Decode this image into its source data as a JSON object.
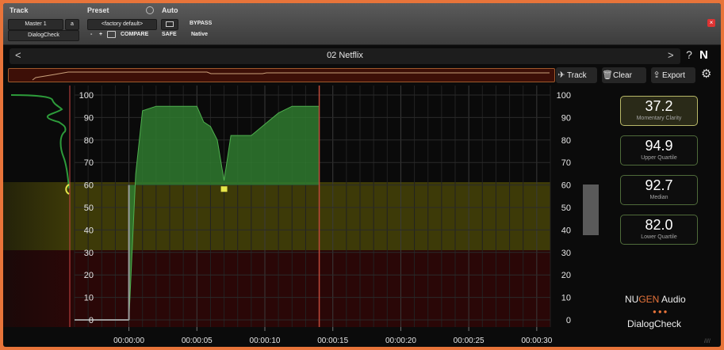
{
  "host": {
    "track_label": "Track",
    "preset_label": "Preset",
    "auto_label": "Auto",
    "track_name": "Master 1",
    "track_suffix": "a",
    "plugin_name": "DialogCheck",
    "preset_name": "<factory default>",
    "minus": "-",
    "plus": "+",
    "compare": "COMPARE",
    "safe": "SAFE",
    "bypass": "BYPASS",
    "native": "Native"
  },
  "titlebar": {
    "title": "02 Netflix",
    "prev": "<",
    "next": ">"
  },
  "toolbar": {
    "help": "?",
    "logo": "N",
    "track": "Track",
    "clear": "Clear",
    "export": "Export"
  },
  "graph": {
    "y_ticks": [
      "100",
      "90",
      "80",
      "70",
      "60",
      "50",
      "40",
      "30",
      "20",
      "10",
      "0"
    ],
    "x_ticks": [
      "00:00:00",
      "00:00:05",
      "00:00:10",
      "00:00:15",
      "00:00:20",
      "00:00:25",
      "00:00:30"
    ]
  },
  "stats": [
    {
      "value": "37.2",
      "label": "Momentary Clarity"
    },
    {
      "value": "94.9",
      "label": "Upper Quartile"
    },
    {
      "value": "92.7",
      "label": "Median"
    },
    {
      "value": "82.0",
      "label": "Lower Quartile"
    }
  ],
  "meter_value": 45,
  "branding": {
    "nu": "NU",
    "gen": "GEN",
    "audio": " Audio",
    "dots": "●●●",
    "product": "DialogCheck"
  },
  "colors": {
    "accent": "#e8743a",
    "good": "#2f7a2f",
    "warn": "#4a4a10",
    "bad": "#3a0a0a"
  },
  "chart_data": {
    "type": "area",
    "title": "02 Netflix",
    "xlabel": "",
    "ylabel": "",
    "ylim": [
      0,
      100
    ],
    "xlim_seconds": [
      -4,
      31
    ],
    "x_seconds": [
      -4,
      0,
      0.5,
      1,
      2,
      5,
      5.5,
      6,
      6.5,
      7,
      7.5,
      8,
      9,
      10,
      11,
      12,
      13,
      14
    ],
    "values": [
      0,
      0,
      65,
      93,
      95,
      95,
      88,
      86,
      80,
      62,
      82,
      82,
      82,
      87,
      92,
      95,
      95,
      95
    ],
    "bands": [
      {
        "name": "good",
        "from": 60,
        "to": 100
      },
      {
        "name": "caution",
        "from": 30,
        "to": 60
      },
      {
        "name": "poor",
        "from": 0,
        "to": 30
      }
    ],
    "cursor_seconds": 14,
    "marker": {
      "x_seconds": 7,
      "y": 58
    }
  }
}
